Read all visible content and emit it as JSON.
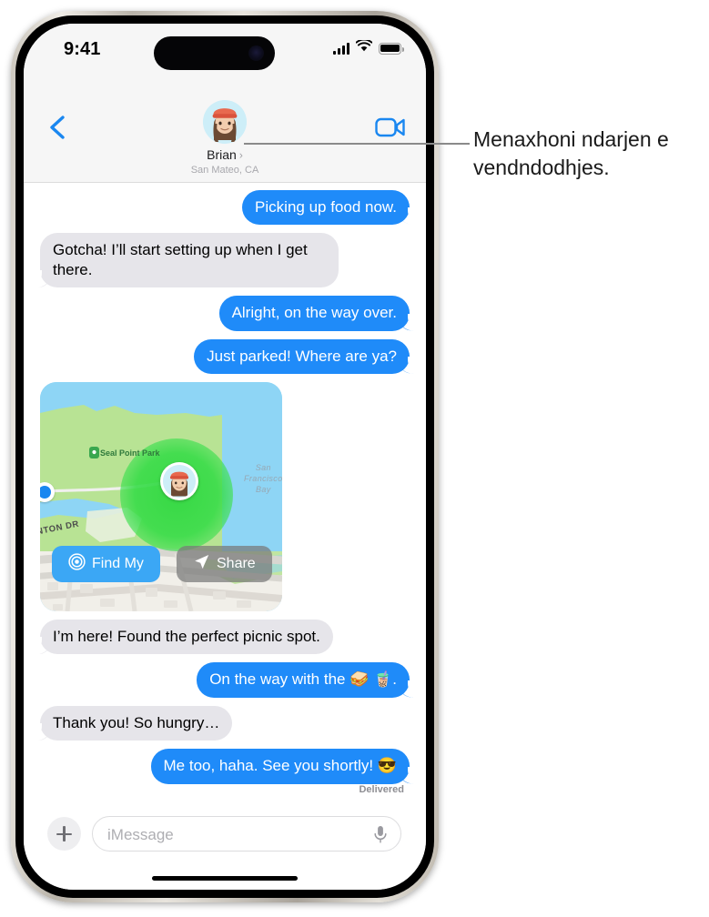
{
  "status_bar": {
    "time": "9:41",
    "cellular_icon": "cellular-signal-icon",
    "wifi_icon": "wifi-icon",
    "battery_icon": "battery-icon"
  },
  "nav_header": {
    "back_icon": "back-chevron-icon",
    "facetime_icon": "video-camera-icon",
    "avatar_icon": "memoji-avatar",
    "contact_name": "Brian",
    "contact_chevron": "›",
    "contact_location": "San Mateo, CA"
  },
  "conversation": {
    "messages": [
      {
        "id": "m1",
        "side": "out",
        "text": "Picking up food now."
      },
      {
        "id": "m2",
        "side": "in",
        "text": "Gotcha! I’ll start setting up when I get there."
      },
      {
        "id": "m3",
        "side": "out",
        "text": "Alright, on the way over."
      },
      {
        "id": "m4",
        "side": "out",
        "text": "Just parked! Where are ya?"
      },
      {
        "id": "m5",
        "side": "in",
        "text": "I’m here! Found the perfect picnic spot."
      },
      {
        "id": "m6",
        "side": "out",
        "text": "On the way with the 🥪 🧋."
      },
      {
        "id": "m7",
        "side": "in",
        "text": "Thank you! So hungry…"
      },
      {
        "id": "m8",
        "side": "out",
        "text": "Me too, haha. See you shortly! 😎"
      }
    ],
    "delivered_label": "Delivered"
  },
  "map_attachment": {
    "park_label": "Seal Point Park",
    "water_label": "San Francisco\nBay",
    "water_label_lines": [
      "San",
      "Francisco",
      "Bay"
    ],
    "road_label": "NTON DR",
    "park_pin_icon": "park-marker-icon",
    "user_pin_icon": "memoji-location-pin",
    "current_location_icon": "blue-location-dot",
    "buttons": [
      {
        "id": "findmy",
        "label": "Find My",
        "icon": "findmy-radar-icon",
        "color": "#3ba7f5"
      },
      {
        "id": "share",
        "label": "Share",
        "icon": "share-arrow-icon",
        "color": "#787878"
      }
    ]
  },
  "input_bar": {
    "plus_icon": "plus-icon",
    "placeholder": "iMessage",
    "mic_icon": "microphone-icon"
  },
  "callout": {
    "text": "Menaxhoni ndarjen e vendndodhjes."
  },
  "colors": {
    "outgoing_bubble": "#1f8bf9",
    "incoming_bubble": "#e6e5ea",
    "accent_blue": "#1a87f0",
    "header_bg": "#f6f6f6",
    "map_water": "#8ed5f5",
    "map_land": "#b8e394",
    "halo_green": "#2cd83e"
  }
}
